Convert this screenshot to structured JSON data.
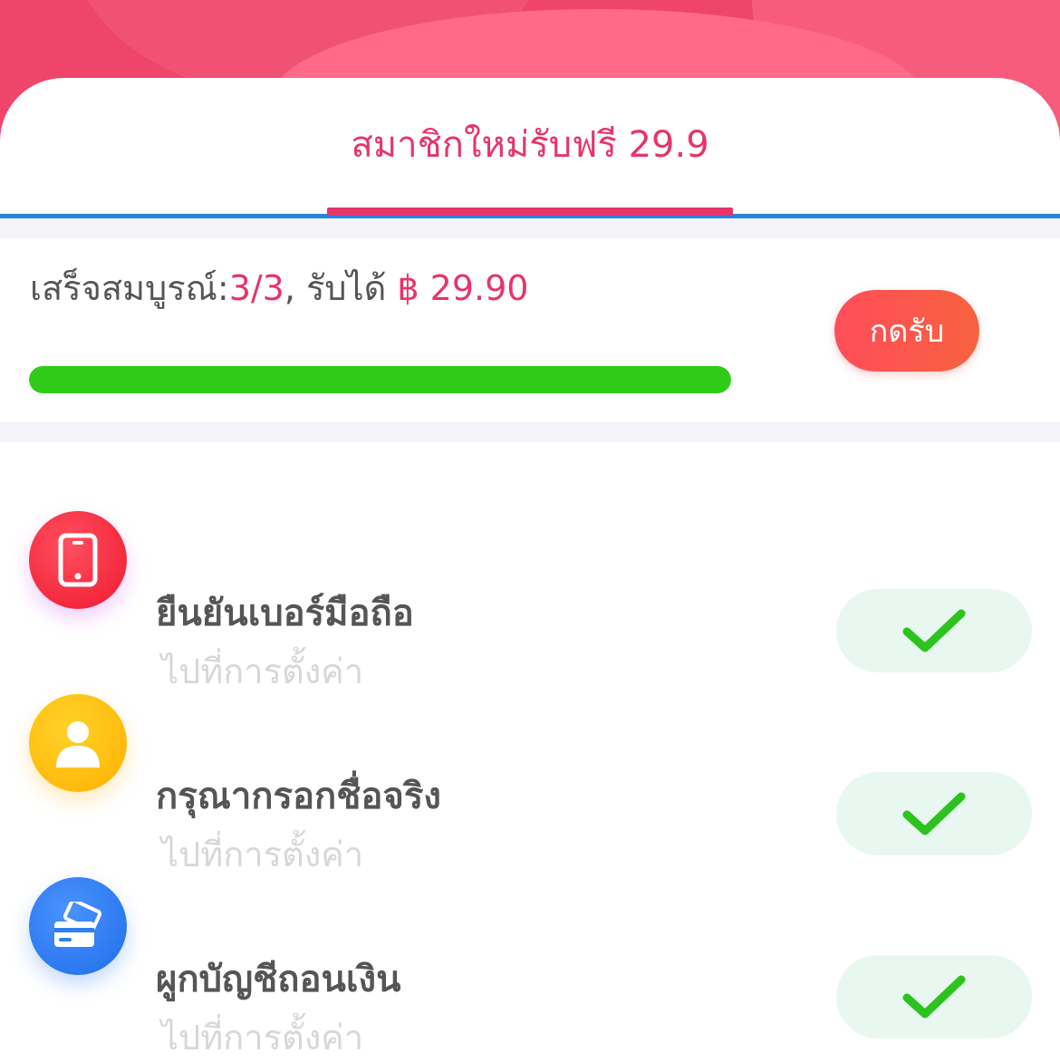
{
  "header": {
    "tab_label": "สมาชิกใหม่รับฟรี 29.9"
  },
  "progress": {
    "prefix": "เสร็จสมบูรณ์:",
    "count": "3/3",
    "middle": ", รับได้ ",
    "amount": "฿ 29.90",
    "fraction": 1.0,
    "claim_label": "กดรับ"
  },
  "tasks": [
    {
      "title": "ยืนยันเบอร์มือถือ",
      "subtitle": "ไปที่การตั้งค่า",
      "icon": "phone-icon",
      "icon_color": "#ff2e44",
      "status": "completed"
    },
    {
      "title": "กรุณากรอกชื่อจริง",
      "subtitle": "ไปที่การตั้งค่า",
      "icon": "user-icon",
      "icon_color": "#ffbf0f",
      "status": "completed"
    },
    {
      "title": "ผูกบัญชีถอนเงิน",
      "subtitle": "ไปที่การตั้งค่า",
      "icon": "card-icon",
      "icon_color": "#2f7ff0",
      "status": "completed"
    }
  ],
  "colors": {
    "accent": "#e5356b",
    "progress_green": "#2ecc17",
    "check_green": "#2dc31f",
    "tab_line_blue": "#2784e0"
  }
}
